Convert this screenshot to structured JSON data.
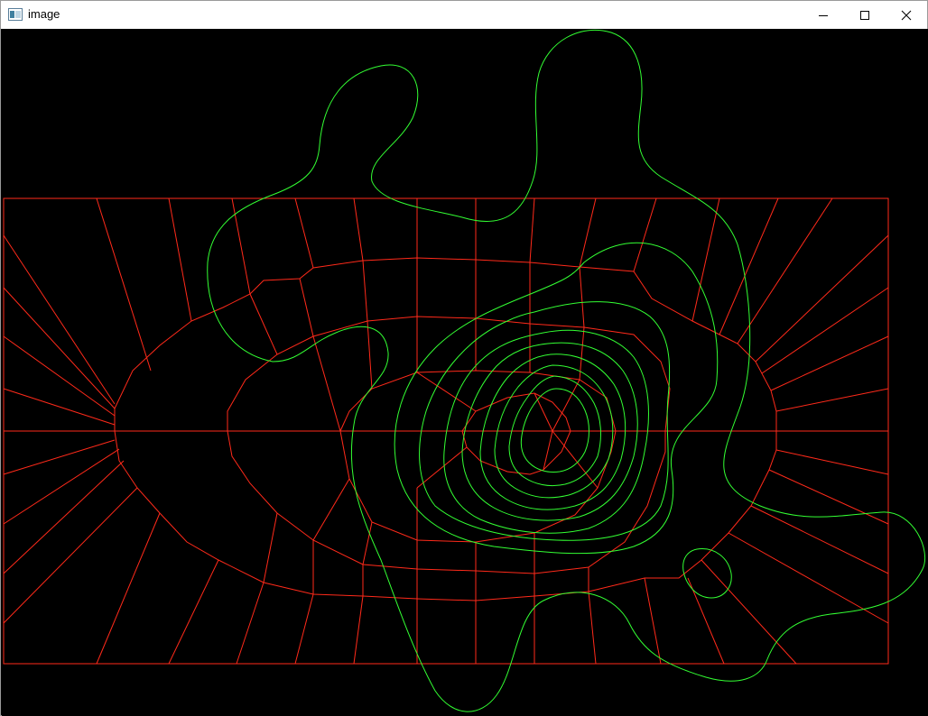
{
  "window": {
    "title": "image",
    "icon": "app-window-icon",
    "controls": {
      "minimize": "minimize-icon",
      "maximize": "maximize-icon",
      "close": "close-icon"
    }
  },
  "canvas": {
    "background_color": "#000000",
    "mesh_color": "#ff0000",
    "contour_color": "#00ff00"
  }
}
